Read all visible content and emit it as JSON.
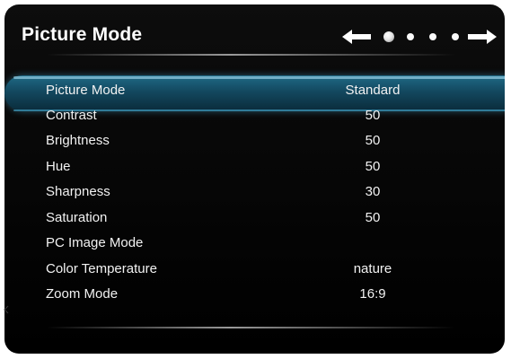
{
  "header": {
    "title": "Picture Mode"
  },
  "pager": {
    "active_index": 1,
    "dot_count": 4
  },
  "menu": {
    "items": [
      {
        "label": "Picture Mode",
        "value": "Standard",
        "selected": true
      },
      {
        "label": "Contrast",
        "value": "50"
      },
      {
        "label": "Brightness",
        "value": "50"
      },
      {
        "label": "Hue",
        "value": "50"
      },
      {
        "label": "Sharpness",
        "value": "30"
      },
      {
        "label": "Saturation",
        "value": "50"
      },
      {
        "label": "PC Image Mode",
        "value": ""
      },
      {
        "label": "Color Temperature",
        "value": "nature"
      },
      {
        "label": "Zoom Mode",
        "value": "16:9"
      }
    ]
  },
  "colors": {
    "background": "#000000",
    "highlight": "#1f6a86",
    "text": "#f2f2f2"
  }
}
